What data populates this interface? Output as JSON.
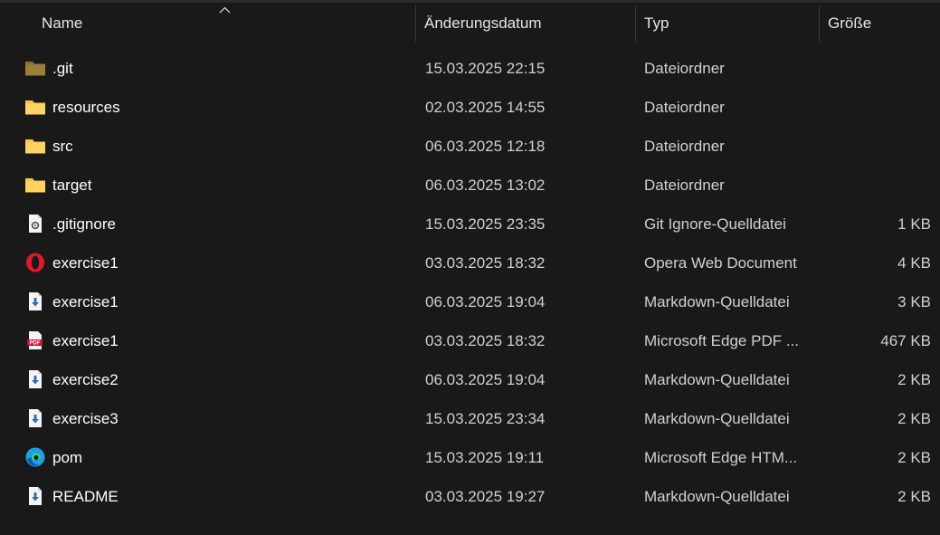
{
  "columns": {
    "name": "Name",
    "date": "Änderungsdatum",
    "type": "Typ",
    "size": "Größe"
  },
  "sort": {
    "column": "name",
    "direction": "ascending"
  },
  "files": [
    {
      "name": ".git",
      "date": "15.03.2025 22:15",
      "type": "Dateiordner",
      "size": "",
      "icon": "folder-hidden-icon"
    },
    {
      "name": "resources",
      "date": "02.03.2025 14:55",
      "type": "Dateiordner",
      "size": "",
      "icon": "folder-icon"
    },
    {
      "name": "src",
      "date": "06.03.2025 12:18",
      "type": "Dateiordner",
      "size": "",
      "icon": "folder-icon"
    },
    {
      "name": "target",
      "date": "06.03.2025 13:02",
      "type": "Dateiordner",
      "size": "",
      "icon": "folder-icon"
    },
    {
      "name": ".gitignore",
      "date": "15.03.2025 23:35",
      "type": "Git Ignore-Quelldatei",
      "size": "1 KB",
      "icon": "settings-file-icon"
    },
    {
      "name": "exercise1",
      "date": "03.03.2025 18:32",
      "type": "Opera Web Document",
      "size": "4 KB",
      "icon": "opera-icon"
    },
    {
      "name": "exercise1",
      "date": "06.03.2025 19:04",
      "type": "Markdown-Quelldatei",
      "size": "3 KB",
      "icon": "markdown-file-icon"
    },
    {
      "name": "exercise1",
      "date": "03.03.2025 18:32",
      "type": "Microsoft Edge PDF ...",
      "size": "467 KB",
      "icon": "pdf-file-icon"
    },
    {
      "name": "exercise2",
      "date": "06.03.2025 19:04",
      "type": "Markdown-Quelldatei",
      "size": "2 KB",
      "icon": "markdown-file-icon"
    },
    {
      "name": "exercise3",
      "date": "15.03.2025 23:34",
      "type": "Markdown-Quelldatei",
      "size": "2 KB",
      "icon": "markdown-file-icon"
    },
    {
      "name": "pom",
      "date": "15.03.2025 19:11",
      "type": "Microsoft Edge HTM...",
      "size": "2 KB",
      "icon": "edge-icon"
    },
    {
      "name": "README",
      "date": "03.03.2025 19:27",
      "type": "Markdown-Quelldatei",
      "size": "2 KB",
      "icon": "markdown-file-icon"
    }
  ],
  "colors": {
    "background": "#191919",
    "folder": "#f8c44e",
    "folder_hidden": "#8d7332",
    "opera": "#e0182d",
    "pdf": "#c8102e",
    "edge": "#1da1e4"
  }
}
